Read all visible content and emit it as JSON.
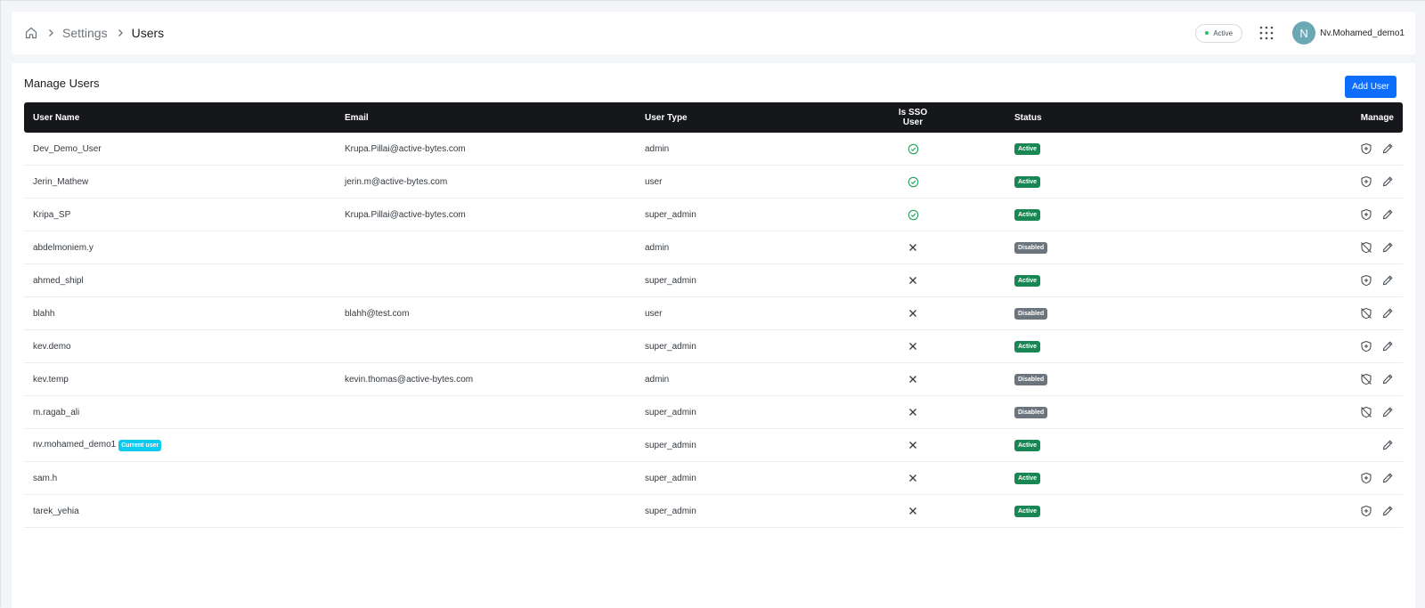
{
  "header": {
    "breadcrumb": [
      "Settings",
      "Users"
    ],
    "status_pill": "Active",
    "avatar_initial": "N",
    "username": "Nv.Mohamed_demo1"
  },
  "page": {
    "title": "Manage Users",
    "add_button": "Add User"
  },
  "table": {
    "columns": [
      "User Name",
      "Email",
      "User Type",
      "Is SSO User",
      "Status",
      "Manage"
    ],
    "rows": [
      {
        "name": "Dev_Demo_User",
        "email": "Krupa.Pillai@active-bytes.com",
        "type": "admin",
        "sso": true,
        "status": "Active"
      },
      {
        "name": "Jerin_Mathew",
        "email": "jerin.m@active-bytes.com",
        "type": "user",
        "sso": true,
        "status": "Active"
      },
      {
        "name": "Kripa_SP",
        "email": "Krupa.Pillai@active-bytes.com",
        "type": "super_admin",
        "sso": true,
        "status": "Active"
      },
      {
        "name": "abdelmoniem.y",
        "email": "",
        "type": "admin",
        "sso": false,
        "status": "Disabled"
      },
      {
        "name": "ahmed_shipl",
        "email": "",
        "type": "super_admin",
        "sso": false,
        "status": "Active"
      },
      {
        "name": "blahh",
        "email": "blahh@test.com",
        "type": "user",
        "sso": false,
        "status": "Disabled"
      },
      {
        "name": "kev.demo",
        "email": "",
        "type": "super_admin",
        "sso": false,
        "status": "Active"
      },
      {
        "name": "kev.temp",
        "email": "kevin.thomas@active-bytes.com",
        "type": "admin",
        "sso": false,
        "status": "Disabled"
      },
      {
        "name": "m.ragab_ali",
        "email": "",
        "type": "super_admin",
        "sso": false,
        "status": "Disabled"
      },
      {
        "name": "nv.mohamed_demo1",
        "email": "",
        "type": "super_admin",
        "sso": false,
        "status": "Active",
        "current_user_badge": "Current user"
      },
      {
        "name": "sam.h",
        "email": "",
        "type": "super_admin",
        "sso": false,
        "status": "Active"
      },
      {
        "name": "tarek_yehia",
        "email": "",
        "type": "super_admin",
        "sso": false,
        "status": "Active"
      }
    ]
  },
  "colors": {
    "primary": "#0d6efd",
    "active_badge": "#198754",
    "disabled_badge": "#6c757d",
    "current_user_badge": "#0dcaf0",
    "sso_check": "#22a35a",
    "table_header": "#15171b"
  },
  "icons": {
    "home": "home-icon",
    "separator": "chevron-right-icon",
    "apps": "apps-grid-icon",
    "sso_yes": "check-circle-icon",
    "sso_no": "x-icon",
    "disable_action": "shield-plus-icon",
    "enable_action": "shield-off-icon",
    "edit_action": "pencil-icon"
  }
}
